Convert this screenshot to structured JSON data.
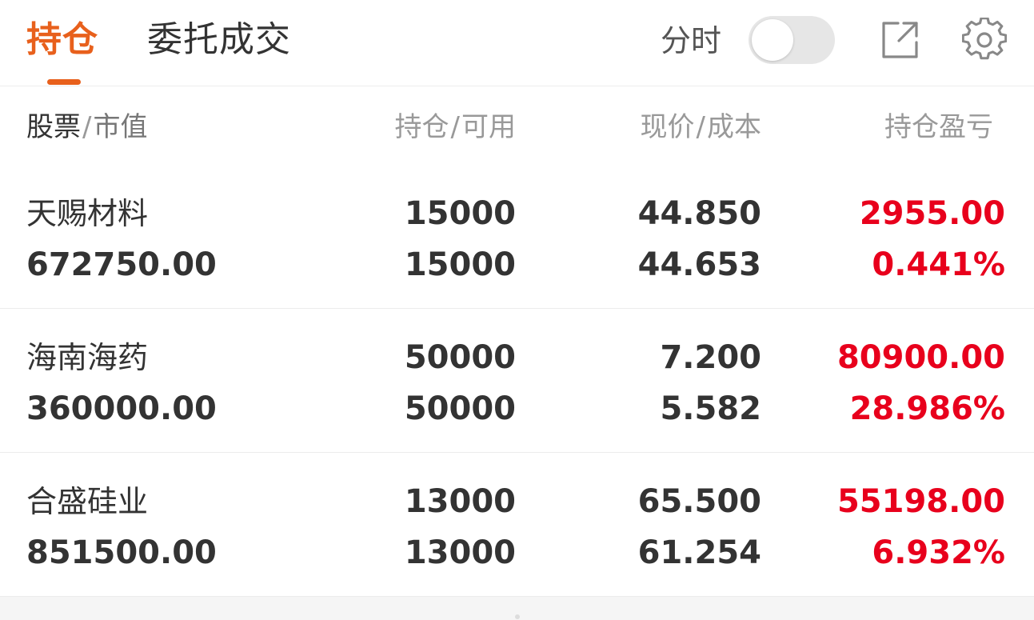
{
  "tabs": {
    "positions": "持仓",
    "orders": "委托成交"
  },
  "header": {
    "timeshare_label": "分时",
    "timeshare_toggle_on": false
  },
  "icons": {
    "share": "share-external-icon",
    "settings": "gear-icon"
  },
  "columns": {
    "stock": {
      "main": "股票",
      "sub": "市值"
    },
    "qty": {
      "main": "持仓",
      "sub": "可用"
    },
    "price": {
      "main": "现价",
      "sub": "成本"
    },
    "pl": "持仓盈亏"
  },
  "separator": "/",
  "rows": [
    {
      "name": "天赐材料",
      "market_value": "672750.00",
      "holding": "15000",
      "available": "15000",
      "price": "44.850",
      "cost": "44.653",
      "pl_amount": "2955.00",
      "pl_pct": "0.441%"
    },
    {
      "name": "海南海药",
      "market_value": "360000.00",
      "holding": "50000",
      "available": "50000",
      "price": "7.200",
      "cost": "5.582",
      "pl_amount": "80900.00",
      "pl_pct": "28.986%"
    },
    {
      "name": "合盛硅业",
      "market_value": "851500.00",
      "holding": "13000",
      "available": "13000",
      "price": "65.500",
      "cost": "61.254",
      "pl_amount": "55198.00",
      "pl_pct": "6.932%"
    }
  ],
  "colors": {
    "accent": "#e8601c",
    "profit": "#e8001c",
    "text": "#333333",
    "muted": "#999999"
  }
}
